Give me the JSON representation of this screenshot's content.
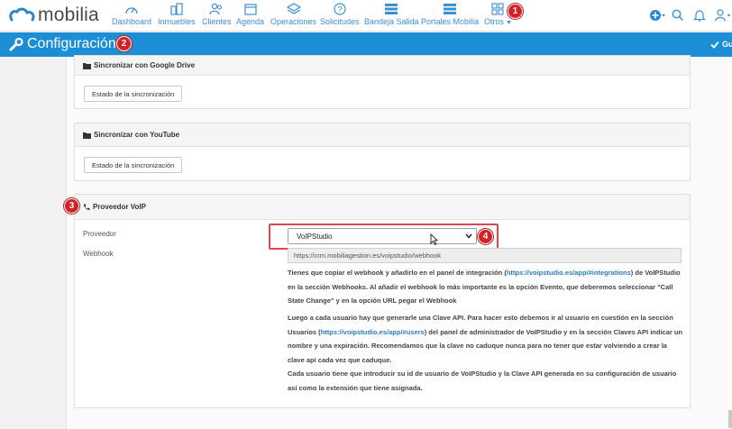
{
  "brand": {
    "name": "mobilia"
  },
  "nav": {
    "items": [
      {
        "label": "Dashboard",
        "icon": "dashboard-gauge-icon"
      },
      {
        "label": "Inmuebles",
        "icon": "buildings-icon"
      },
      {
        "label": "Clientes",
        "icon": "users-icon"
      },
      {
        "label": "Agenda",
        "icon": "calendar-icon"
      },
      {
        "label": "Operaciones",
        "icon": "layers-icon"
      },
      {
        "label": "Solicitudes",
        "icon": "question-icon"
      },
      {
        "label": "Bandeja Salida",
        "icon": "list-icon"
      },
      {
        "label": "Portales Mobilia",
        "icon": "list-icon"
      },
      {
        "label": "Otros",
        "icon": "grid-icon"
      }
    ],
    "right_icons": [
      "add-circle-icon",
      "search-icon",
      "bell-icon",
      "user-icon"
    ]
  },
  "annotations": {
    "b1": "1",
    "b2": "2",
    "b3": "3",
    "b4": "4"
  },
  "config": {
    "title": "Configuración",
    "save_label": "Gua"
  },
  "panels": {
    "drive": {
      "title": "Sincronizar con Google Drive",
      "button": "Estado de la sincronización"
    },
    "youtube": {
      "title": "Sincronizar con YouTube",
      "button": "Estado de la sincronización"
    },
    "voip": {
      "title": "Proveedor VoIP",
      "provider_label": "Proveedor",
      "provider_value": "VoIPStudio",
      "webhook_label": "Webhook",
      "webhook_value": "https://crm.mobiliagestion.es/voipstudio/webhook",
      "p1_a": "Tienes que copiar el webhook y añadirlo en el panel de integración (",
      "p1_link": "https://voipstudio.es/app/#integrations",
      "p1_b": ") de VoIPStudio en la sección Webhooks. Al añadir el webhook lo más importante es la opción Evento, que deberemos seleccionar \"Call State Change\" y en la opción URL pegar el Webhook",
      "p2_a": "Luego a cada usuario hay que generarle una Clave API. Para hacer esto debemos ir al usuario en cuestión en la sección Usuarios (",
      "p2_link": "https://voipstudio.es/app/#users",
      "p2_b": ") del panel de administrador de VoIPStudio y en la sección Claves API indicar un nombre y una expiración. Recomendamos que la clave no caduque nunca para no tener que estar volviendo a crear la clave api cada vez que caduque.",
      "p3": "Cada usuario tiene que introducir su id de usuario de VoIPStudio y la Clave API generada en su configuración de usuario así como la extensión que tiene asignada."
    }
  },
  "colors": {
    "primary": "#1c8ed6",
    "nav_link": "#3b8fd4",
    "badge": "#d32027",
    "highlight": "#e0474c"
  }
}
